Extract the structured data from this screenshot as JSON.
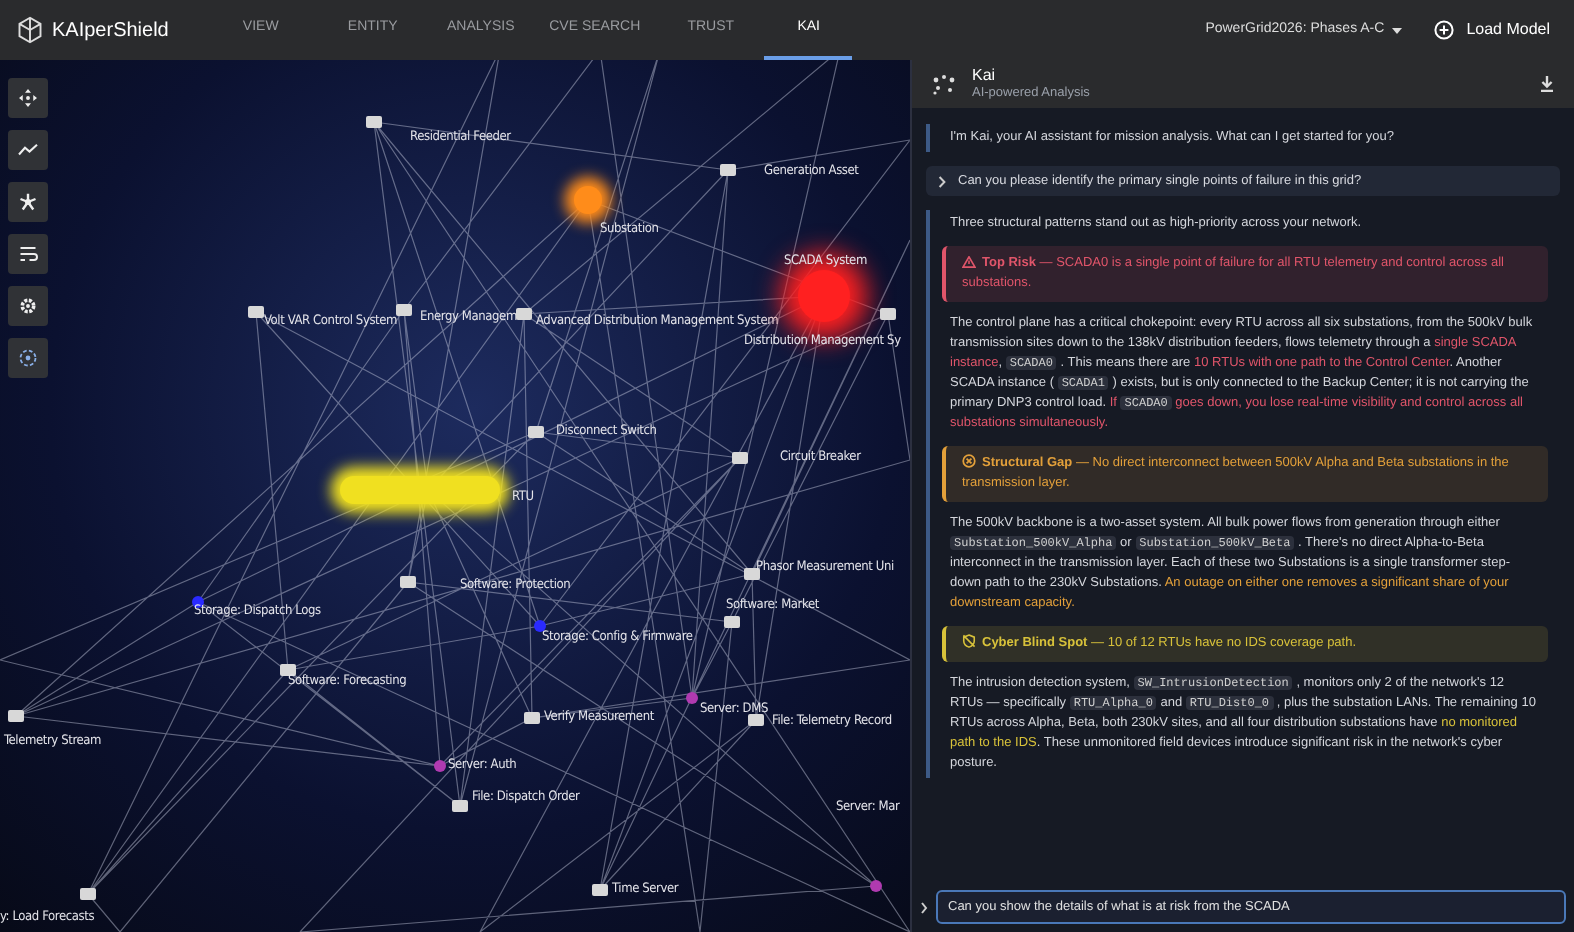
{
  "app": {
    "name": "KAIperShield"
  },
  "nav": [
    {
      "label": "VIEW",
      "selected": false
    },
    {
      "label": "ENTITY",
      "selected": false
    },
    {
      "label": "ANALYSIS",
      "selected": false
    },
    {
      "label": "CVE SEARCH",
      "selected": false
    },
    {
      "label": "TRUST",
      "selected": false
    },
    {
      "label": "KAI",
      "selected": true
    }
  ],
  "model_select": {
    "value": "PowerGrid2026: Phases A-C"
  },
  "load_model": {
    "label": "Load Model"
  },
  "graph": {
    "nodes": [
      {
        "label": "Residential Feeder"
      },
      {
        "label": "Generation Asset"
      },
      {
        "label": "Substation",
        "color": "#ff8c1a"
      },
      {
        "label": "Volt VAR Control System"
      },
      {
        "label": "Energy Managem"
      },
      {
        "label": "Advanced Distribution Management System"
      },
      {
        "label": "SCADA System",
        "color": "#ff2020"
      },
      {
        "label": "Distribution Management Sy"
      },
      {
        "label": "Disconnect Switch"
      },
      {
        "label": "Circuit Breaker"
      },
      {
        "label": "RTU",
        "color": "#f0e020"
      },
      {
        "label": "Phasor Measurement Uni"
      },
      {
        "label": "Software: Protection"
      },
      {
        "label": "Storage: Dispatch Logs",
        "color": "#2a2aff"
      },
      {
        "label": "Storage: Config & Firmware",
        "color": "#2a2aff"
      },
      {
        "label": "Software: Market"
      },
      {
        "label": "Software: Forecasting"
      },
      {
        "label": "Verify Measurement"
      },
      {
        "label": "Server: DMS",
        "color": "#b03ab0"
      },
      {
        "label": "File: Telemetry Record"
      },
      {
        "label": "Telemetry Stream"
      },
      {
        "label": "Server: Auth",
        "color": "#b03ab0"
      },
      {
        "label": "File: Dispatch Order"
      },
      {
        "label": "Server: Mar",
        "color": "#b03ab0"
      },
      {
        "label": "Time Server"
      },
      {
        "label": "y: Load Forecasts"
      }
    ]
  },
  "chat": {
    "title": "Kai",
    "subtitle": "AI-powered Analysis",
    "messages": [
      {
        "kind": "assistant",
        "blocks": [
          {
            "kind": "paragraph",
            "segments": [
              {
                "kind": "text",
                "text": "I'm Kai, your AI assistant for mission analysis. What can I get started for you?"
              }
            ]
          }
        ]
      },
      {
        "kind": "user",
        "expanded": false,
        "text": "Can you please identify the primary single points of failure in this grid?"
      },
      {
        "kind": "assistant",
        "blocks": [
          {
            "kind": "paragraph",
            "segments": [
              {
                "kind": "text",
                "text": "Three structural patterns stand out as high-priority across your network."
              }
            ]
          },
          {
            "kind": "callout",
            "color": "#e0556a",
            "title": "Top Risk",
            "text": "— SCADA0 is a single point of failure for all RTU telemetry and control across all substations."
          },
          {
            "kind": "paragraph",
            "color": "#e0556a",
            "segments": [
              {
                "kind": "text",
                "text": "The control plane has a critical chokepoint: every RTU across all six substations, from the 500kV bulk transmission sites down to the 138kV distribution feeders, flows telemetry through a "
              },
              {
                "kind": "emph",
                "text": "single SCADA instance"
              },
              {
                "kind": "text",
                "text": ", "
              },
              {
                "kind": "code",
                "text": "SCADA0"
              },
              {
                "kind": "text",
                "text": " . This means there are "
              },
              {
                "kind": "emph",
                "text": "10 RTUs with one path to the Control Center"
              },
              {
                "kind": "text",
                "text": ". Another SCADA instance ( "
              },
              {
                "kind": "code",
                "text": "SCADA1"
              },
              {
                "kind": "text",
                "text": " ) exists, but is only connected to the Backup Center; it is not carrying the primary DNP3 control load. "
              },
              {
                "kind": "emph",
                "text": "If "
              },
              {
                "kind": "code",
                "text": "SCADA0"
              },
              {
                "kind": "emph",
                "text": " goes down, you lose real-time visibility and control across all substations simultaneously."
              }
            ]
          },
          {
            "kind": "callout",
            "color": "#e3a03a",
            "title": "Structural Gap",
            "text": "— No direct interconnect between 500kV Alpha and Beta substations in the transmission layer."
          },
          {
            "kind": "paragraph",
            "color": "#e3a03a",
            "segments": [
              {
                "kind": "text",
                "text": "The 500kV backbone is a two-asset system. All bulk power flows from generation through either "
              },
              {
                "kind": "code",
                "text": "Substation_500kV_Alpha"
              },
              {
                "kind": "text",
                "text": " or "
              },
              {
                "kind": "code",
                "text": "Substation_500kV_Beta"
              },
              {
                "kind": "text",
                "text": " . There's no direct Alpha-to-Beta interconnect in the transmission layer. Each of these two Substations is a single transformer step-down path to the 230kV Substations. "
              },
              {
                "kind": "emph",
                "text": "An outage on either one removes a significant share of your downstream capacity."
              }
            ]
          },
          {
            "kind": "callout",
            "color": "#d8c23a",
            "title": "Cyber Blind Spot",
            "text": "— 10 of 12 RTUs have no IDS coverage path."
          },
          {
            "kind": "paragraph",
            "color": "#d8c23a",
            "segments": [
              {
                "kind": "text",
                "text": "The intrusion detection system, "
              },
              {
                "kind": "code",
                "text": "SW_IntrusionDetection"
              },
              {
                "kind": "text",
                "text": " , monitors only 2 of the network's 12 RTUs — specifically "
              },
              {
                "kind": "code",
                "text": "RTU_Alpha_0"
              },
              {
                "kind": "text",
                "text": " and "
              },
              {
                "kind": "code",
                "text": "RTU_Dist0_0"
              },
              {
                "kind": "text",
                "text": " , plus the substation LANs. The remaining 10 RTUs across Alpha, Beta, both 230kV sites, and all four distribution substations have "
              },
              {
                "kind": "emph",
                "text": "no monitored path to the IDS"
              },
              {
                "kind": "text",
                "text": ". These unmonitored field devices introduce significant risk in the network's cyber posture."
              }
            ]
          }
        ]
      }
    ],
    "input": {
      "value": "Can you show the details of what is at risk from the SCADA"
    }
  }
}
